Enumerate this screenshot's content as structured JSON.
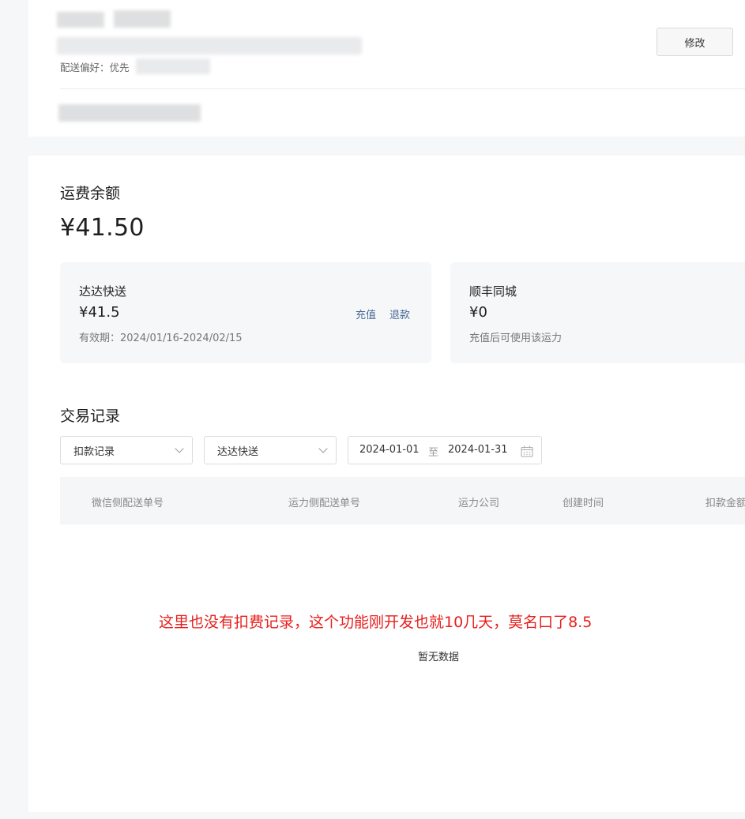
{
  "header": {
    "edit_label": "修改",
    "delivery_pref_label": "配送偏好：优先"
  },
  "balance": {
    "title": "运费余额",
    "amount": "¥41.50"
  },
  "carriers": [
    {
      "name": "达达快送",
      "amount": "¥41.5",
      "note": "有效期：2024/01/16-2024/02/15",
      "recharge_label": "充值",
      "refund_label": "退款"
    },
    {
      "name": "顺丰同城",
      "amount": "¥0",
      "note": "充值后可使用该运力"
    }
  ],
  "transactions": {
    "title": "交易记录",
    "type_select": "扣款记录",
    "carrier_select": "达达快送",
    "date_start": "2024-01-01",
    "date_separator": "至",
    "date_end": "2024-01-31",
    "columns": [
      "微信侧配送单号",
      "运力侧配送单号",
      "运力公司",
      "创建时间",
      "扣款金额"
    ],
    "empty_text": "暂无数据"
  },
  "annotation": "这里也没有扣费记录，这个功能刚开发也就10几天，莫名口了8.5",
  "colors": {
    "link": "#4a6a94",
    "annotation": "#e8201e"
  }
}
